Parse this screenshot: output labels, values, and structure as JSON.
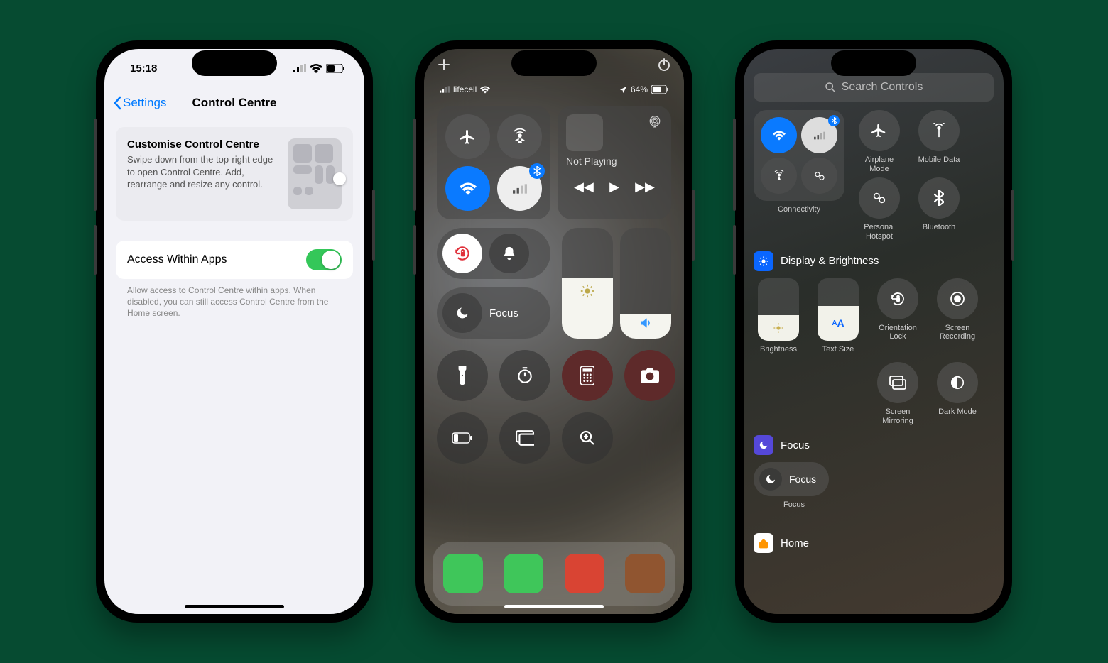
{
  "phone1": {
    "time": "15:18",
    "back_label": "Settings",
    "title": "Control Centre",
    "card": {
      "title": "Customise Control Centre",
      "body": "Swipe down from the top-right edge to open Control Centre. Add, rearrange and resize any control."
    },
    "access_label": "Access Within Apps",
    "access_enabled": true,
    "footer": "Allow access to Control Centre within apps. When disabled, you can still access Control Centre from the Home screen."
  },
  "phone2": {
    "carrier": "lifecell",
    "battery_text": "64%",
    "media_label": "Not Playing",
    "focus_label": "Focus",
    "brightness_level": 0.55,
    "volume_level": 0.22,
    "connectivity": {
      "airplane_on": false,
      "airdrop_on": false,
      "wifi_on": true,
      "bluetooth_on": true
    },
    "controls_row2": {
      "rotation_lock_on": true,
      "silent_on": false
    },
    "bottom_icons": [
      "flashlight-icon",
      "timer-icon",
      "calculator-icon",
      "camera-icon",
      "low-power-icon",
      "screen-mirroring-icon",
      "magnifier-icon"
    ]
  },
  "phone3": {
    "search_placeholder": "Search Controls",
    "net": {
      "items": [
        {
          "key": "connectivity",
          "label": "Connectivity"
        },
        {
          "key": "airplane",
          "label": "Airplane Mode"
        },
        {
          "key": "mobiledata",
          "label": "Mobile Data"
        },
        {
          "key": "hotspot",
          "label": "Personal Hotspot"
        },
        {
          "key": "bluetooth",
          "label": "Bluetooth"
        }
      ]
    },
    "display_header": "Display & Brightness",
    "display_items": [
      {
        "key": "brightness",
        "label": "Brightness"
      },
      {
        "key": "textsize",
        "label": "Text Size",
        "badge": "AA"
      },
      {
        "key": "orientation",
        "label": "Orientation Lock"
      },
      {
        "key": "recording",
        "label": "Screen Recording"
      },
      {
        "key": "mirroring",
        "label": "Screen Mirroring"
      },
      {
        "key": "darkmode",
        "label": "Dark Mode"
      }
    ],
    "focus_header": "Focus",
    "focus_chip_label": "Focus",
    "focus_sublabel": "Focus",
    "home_header": "Home"
  }
}
